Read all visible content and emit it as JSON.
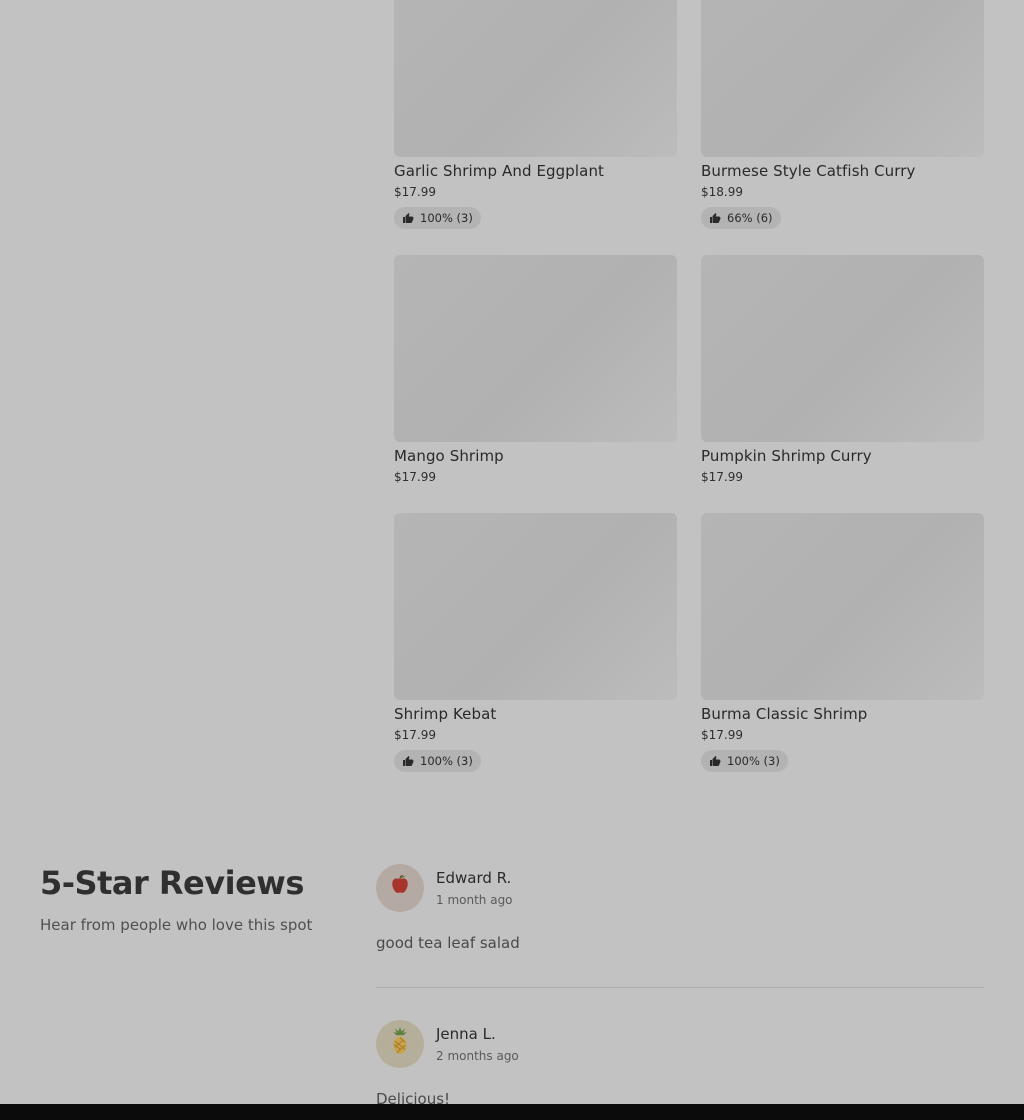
{
  "menu_items": [
    {
      "name": "Garlic Shrimp And Eggplant",
      "price": "$17.99",
      "rating": "100% (3)"
    },
    {
      "name": "Burmese Style Catfish Curry",
      "price": "$18.99",
      "rating": "66% (6)"
    },
    {
      "name": "Mango Shrimp",
      "price": "$17.99"
    },
    {
      "name": "Pumpkin Shrimp Curry",
      "price": "$17.99"
    },
    {
      "name": "Shrimp Kebat",
      "price": "$17.99",
      "rating": "100% (3)"
    },
    {
      "name": "Burma Classic Shrimp",
      "price": "$17.99",
      "rating": "100% (3)"
    }
  ],
  "reviews_section": {
    "title": "5-Star Reviews",
    "subtitle": "Hear from people who love this spot"
  },
  "reviews": [
    {
      "author": "Edward R.",
      "time": "1 month ago",
      "text": "good tea leaf salad",
      "avatar_icon": "apple-icon"
    },
    {
      "author": "Jenna L.",
      "time": "2 months ago",
      "text": "Delicious!",
      "avatar_icon": "pineapple-icon"
    }
  ]
}
